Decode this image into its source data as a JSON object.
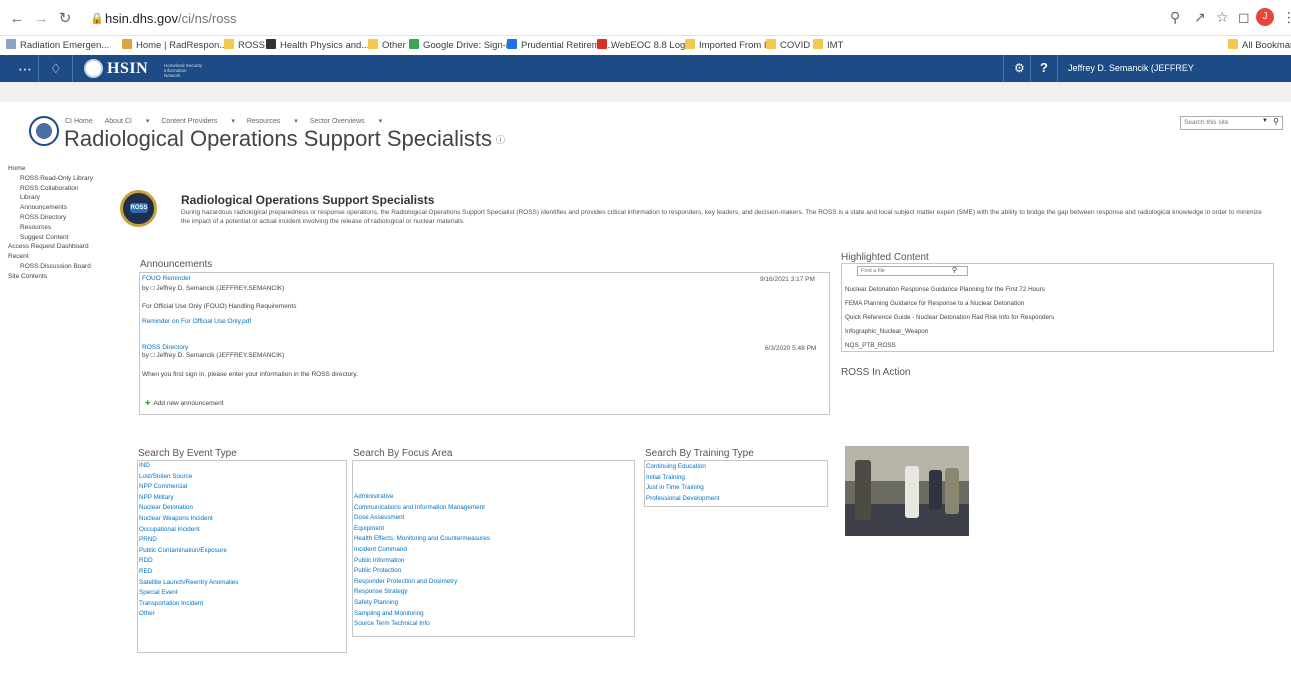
{
  "browser": {
    "url_host": "hsin.dhs.gov",
    "url_path": "/ci/ns/ross",
    "profile_initial": "J"
  },
  "bookmarks": [
    {
      "label": "Radiation Emergen...",
      "color": "#8aa4c8"
    },
    {
      "label": "Home | RadRespon...",
      "color": "#d9a441"
    },
    {
      "label": "ROSS",
      "color": "#f2c94c"
    },
    {
      "label": "Health Physics and...",
      "color": "#333333"
    },
    {
      "label": "Other",
      "color": "#f2c94c"
    },
    {
      "label": "Google Drive: Sign-in",
      "color": "#34a853"
    },
    {
      "label": "Prudential Retireme...",
      "color": "#1a73e8"
    },
    {
      "label": "WebEOC 8.8 Login",
      "color": "#d93025"
    },
    {
      "label": "Imported From IE",
      "color": "#f2c94c"
    },
    {
      "label": "COVID",
      "color": "#f2c94c"
    },
    {
      "label": "IMT",
      "color": "#f2c94c"
    }
  ],
  "all_bookmarks": "All Bookmark",
  "hsin": {
    "brand": "HSIN",
    "brand_sub": "Homeland Security Information Network",
    "user": "Jeffrey D. Semancik (JEFFREY"
  },
  "site": {
    "topnav": [
      "CI Home",
      "About CI",
      "Content Providers",
      "Resources",
      "Sector Overviews"
    ],
    "title": "Radiological Operations Support Specialists",
    "search_placeholder": "Search this site"
  },
  "leftnav": [
    {
      "label": "Home",
      "sub": false
    },
    {
      "label": "ROSS Read-Only Library",
      "sub": true
    },
    {
      "label": "ROSS Collaboration",
      "sub": true
    },
    {
      "label": "Library",
      "sub": true
    },
    {
      "label": "Announcements",
      "sub": true
    },
    {
      "label": "ROSS Directory",
      "sub": true
    },
    {
      "label": "Resources",
      "sub": true
    },
    {
      "label": "Suggest Content",
      "sub": true
    },
    {
      "label": "Access Request Dashboard",
      "sub": false
    },
    {
      "label": "Recent",
      "sub": false
    },
    {
      "label": "ROSS Discussion Board",
      "sub": true
    },
    {
      "label": "Site Contents",
      "sub": false
    }
  ],
  "intro": {
    "logo_text": "ROSS",
    "heading": "Radiological Operations Support Specialists",
    "desc": "During hazardous radiological preparedness or response operations, the Radiological Operations Support Specialist (ROSS) identifies and provides critical information to responders, key leaders, and decision-makers. The ROSS is a state and local subject matter expert (SME) with the ability to bridge the gap between response and radiological knowledge in order to minimize the impact of a potential or actual incident involving the release of radiological or nuclear materials."
  },
  "announcements": {
    "title": "Announcements",
    "items": [
      {
        "title": "FOUO Reminder",
        "by": "by □ Jeffrey D. Semancik (JEFFREY.SEMANCIK)",
        "date": "9/16/2021 3:17 PM",
        "body": "For Official Use Only (FOUO) Handling Requirements",
        "attachment": "Reminder on For Official Use Only.pdf"
      },
      {
        "title": "ROSS Directory",
        "by": "by □ Jeffrey D. Semancik (JEFFREY.SEMANCIK)",
        "date": "6/3/2020 5:48 PM",
        "body": "When you first sign in, please enter your information in the ROSS directory."
      }
    ],
    "add_label": "Add new announcement"
  },
  "highlighted": {
    "title": "Highlighted Content",
    "search_placeholder": "Find a file",
    "items": [
      "Nuclear Detonation Response Guidance Planning for the First 72 Hours",
      "FEMA Planning Guidance for Response to a Nuclear Detonation",
      "Quick Reference Guide - Nuclear Detonation Rad Risk Info for Responders",
      "Infographic_Nuclear_Weapon",
      "NQS_PTB_ROSS"
    ]
  },
  "ross_in_action": "ROSS In Action",
  "event_type": {
    "title": "Search By Event Type",
    "items": [
      "IND",
      "Lost/Stolen Source",
      "NPP Commercial",
      "NPP Military",
      "Nuclear Detonation",
      "Nuclear Weapons Incident",
      "Occupational Incident",
      "PRND",
      "Public Contamination/Exposure",
      "RDD",
      "RED",
      "Satellite Launch/Reentry Anomalies",
      "Special Event",
      "Transportation Incident",
      "Other"
    ]
  },
  "focus_area": {
    "title": "Search By Focus Area",
    "items": [
      "Administrative",
      "Communications and Information Management",
      "Dose Assessment",
      "Equipment",
      "Health Effects, Monitoring and Countermeasures",
      "Incident Command",
      "Public Information",
      "Public Protection",
      "Responder Protection and Dosimetry",
      "Response Strategy",
      "Safety Planning",
      "Sampling and Monitoring",
      "Source Term Technical Info"
    ]
  },
  "training_type": {
    "title": "Search By Training Type",
    "items": [
      "Continuing Education",
      "Initial Training",
      "Just in Time Training",
      "Professional Development"
    ]
  }
}
